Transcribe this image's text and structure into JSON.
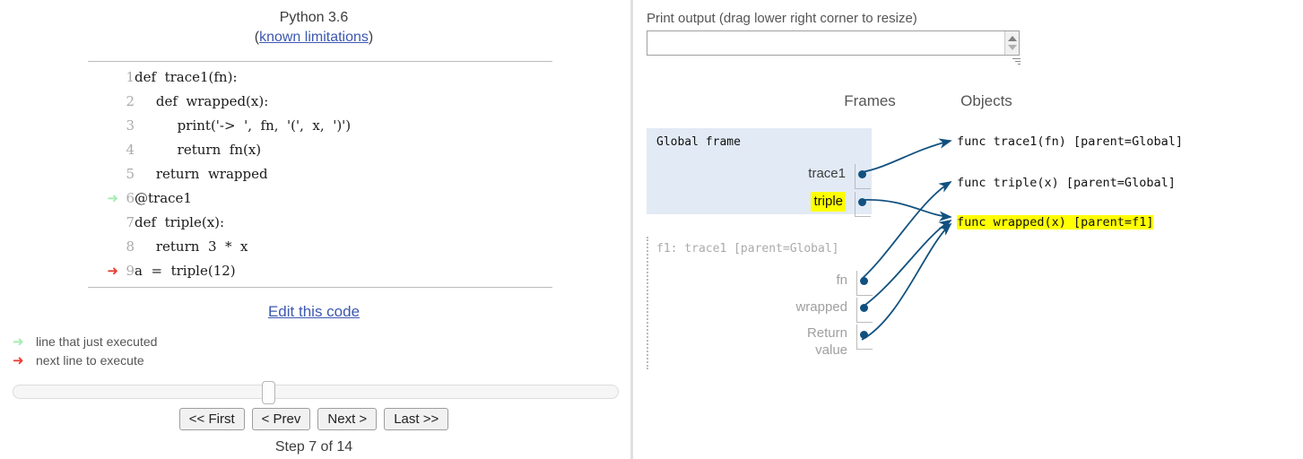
{
  "left": {
    "python_version": "Python 3.6",
    "limitations_prefix": "(",
    "limitations_link": "known limitations",
    "limitations_suffix": ")",
    "code": [
      {
        "lineno": "1",
        "text": "def  trace1(fn):",
        "arrow": "none"
      },
      {
        "lineno": "2",
        "text": "     def  wrapped(x):",
        "arrow": "none"
      },
      {
        "lineno": "3",
        "text": "          print('->  ',  fn,  '(',  x,  ')')",
        "arrow": "none"
      },
      {
        "lineno": "4",
        "text": "          return  fn(x)",
        "arrow": "none"
      },
      {
        "lineno": "5",
        "text": "     return  wrapped",
        "arrow": "none"
      },
      {
        "lineno": "6",
        "text": "@trace1",
        "arrow": "green"
      },
      {
        "lineno": "7",
        "text": "def  triple(x):",
        "arrow": "none"
      },
      {
        "lineno": "8",
        "text": "     return  3  *  x",
        "arrow": "none"
      },
      {
        "lineno": "9",
        "text": "a  =  triple(12)",
        "arrow": "red"
      }
    ],
    "edit_this_code": "Edit this code",
    "legend": [
      {
        "arrow": "green",
        "label": "line that just executed"
      },
      {
        "arrow": "red",
        "label": "next line to execute"
      }
    ],
    "slider": {
      "position_percent": 42
    },
    "buttons": [
      {
        "label": "<< First",
        "name": "first-button"
      },
      {
        "label": "< Prev",
        "name": "prev-button"
      },
      {
        "label": "Next >",
        "name": "next-button"
      },
      {
        "label": "Last >>",
        "name": "last-button"
      }
    ],
    "step_status": "Step 7 of 14"
  },
  "right": {
    "print_output_label": "Print output (drag lower right corner to resize)",
    "print_output_value": "",
    "frames_header": "Frames",
    "objects_header": "Objects",
    "frames": [
      {
        "title": "Global frame",
        "zombie": false,
        "vars": [
          {
            "name": "trace1",
            "highlighted": false
          },
          {
            "name": "triple",
            "highlighted": true
          }
        ]
      },
      {
        "title": "f1: trace1 [parent=Global]",
        "zombie": true,
        "vars": [
          {
            "name": "fn",
            "highlighted": false
          },
          {
            "name": "wrapped",
            "highlighted": false
          },
          {
            "name": "Return\nvalue",
            "highlighted": false
          }
        ]
      }
    ],
    "objects": [
      {
        "text": "func trace1(fn) [parent=Global]",
        "highlighted": false
      },
      {
        "text": "func triple(x) [parent=Global]",
        "highlighted": false
      },
      {
        "text": "func wrapped(x) [parent=f1]",
        "highlighted": true
      }
    ]
  },
  "colors": {
    "arrow_blue": "#11517f",
    "highlight_yellow": "#ffff00",
    "frame_bg": "#e2eaf5",
    "link_blue": "#3d58b0",
    "green_arrow": "#a2eeb0",
    "red_arrow": "#e93f34"
  }
}
